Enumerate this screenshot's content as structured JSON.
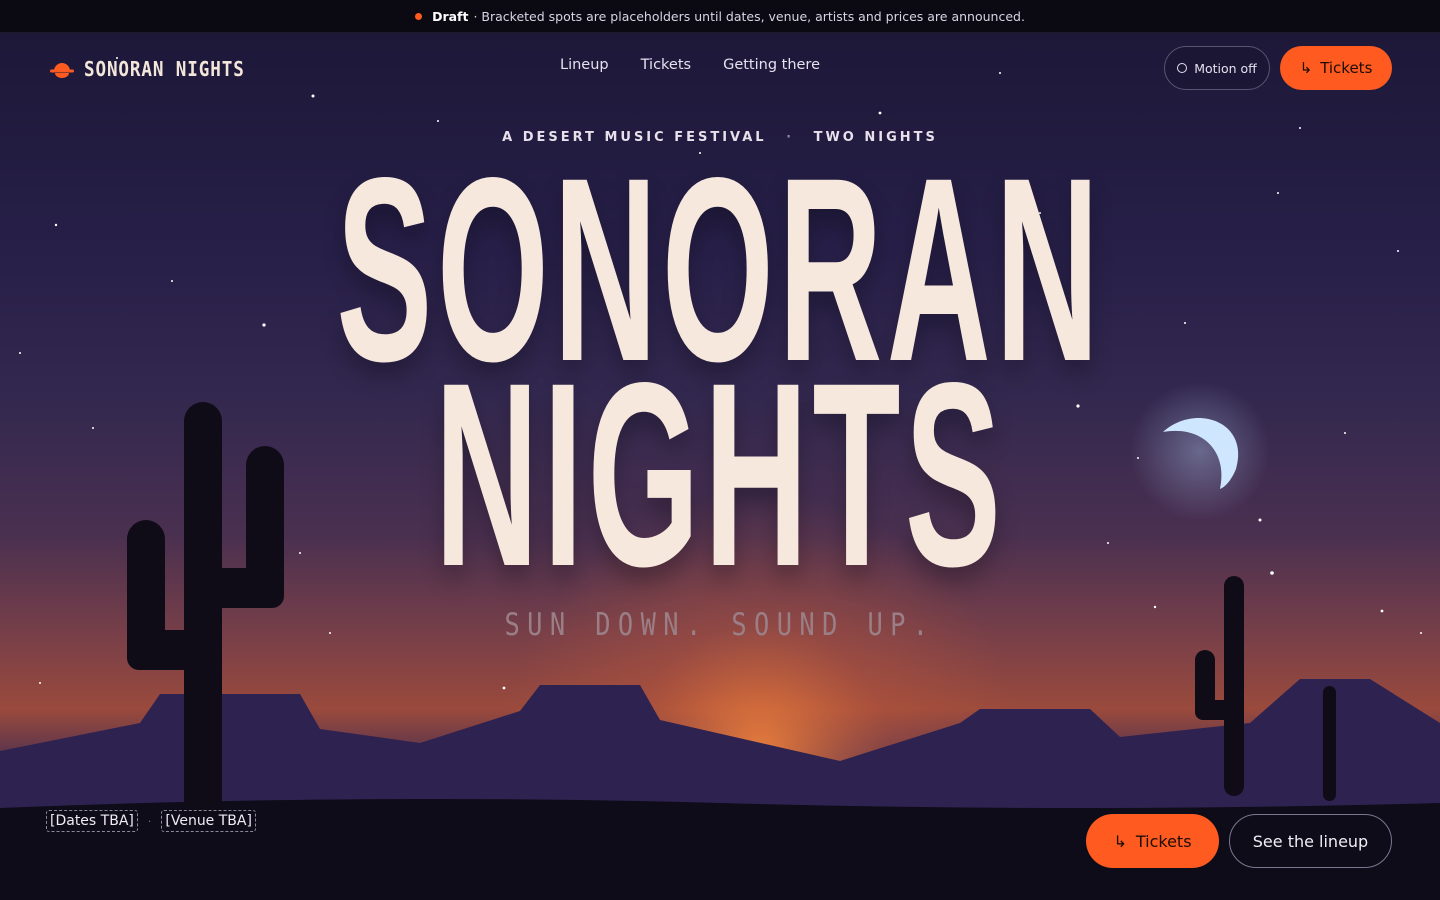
{
  "banner": {
    "status": "Draft",
    "message": "· Bracketed spots are placeholders until dates, venue, artists and prices are announced."
  },
  "brand": {
    "name": "SONORAN NIGHTS",
    "logo_icon": "sunset-icon"
  },
  "nav": {
    "items": [
      {
        "label": "Lineup"
      },
      {
        "label": "Tickets"
      },
      {
        "label": "Getting there"
      }
    ]
  },
  "header": {
    "motion_label": "Motion off",
    "tickets_label": "Tickets",
    "tickets_icon": "↳"
  },
  "hero": {
    "eyebrow_left": "A DESERT MUSIC FESTIVAL",
    "eyebrow_sep": "·",
    "eyebrow_right": "TWO NIGHTS",
    "title_line1": "SONORAN",
    "title_line2": "NIGHTS",
    "tagline": "SUN DOWN. SOUND UP."
  },
  "footer": {
    "dates": "[Dates TBA]",
    "separator": "·",
    "venue": "[Venue TBA]",
    "tickets_label": "Tickets",
    "tickets_icon": "↳",
    "lineup_label": "See the lineup"
  },
  "colors": {
    "accent": "#ff5a1f",
    "title": "#f6e8dc",
    "sky_top": "#1d1838",
    "ground": "#0e0c18"
  }
}
